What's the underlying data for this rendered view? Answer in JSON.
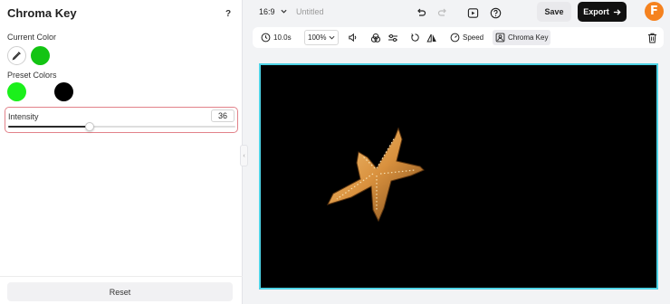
{
  "panel": {
    "title": "Chroma Key",
    "help_label": "?",
    "current_color_label": "Current Color",
    "current_color": "#13c413",
    "preset_colors_label": "Preset Colors",
    "preset_colors": [
      "#1bf01b",
      "#ffffff",
      "#000000"
    ],
    "intensity": {
      "label": "Intensity",
      "value": "36",
      "fraction": 0.36
    },
    "reset_label": "Reset"
  },
  "topbar": {
    "ratio": "16:9",
    "title": "Untitled",
    "save_label": "Save",
    "export_label": "Export",
    "brand_letter": "F",
    "brand_color": "#f5821f"
  },
  "toolbar": {
    "duration": "10.0s",
    "zoom": "100%",
    "speed_label": "Speed",
    "chroma_label": "Chroma Key"
  },
  "canvas": {
    "background": "#000000",
    "selection_color": "#4fd3e6",
    "subject": "starfish"
  }
}
